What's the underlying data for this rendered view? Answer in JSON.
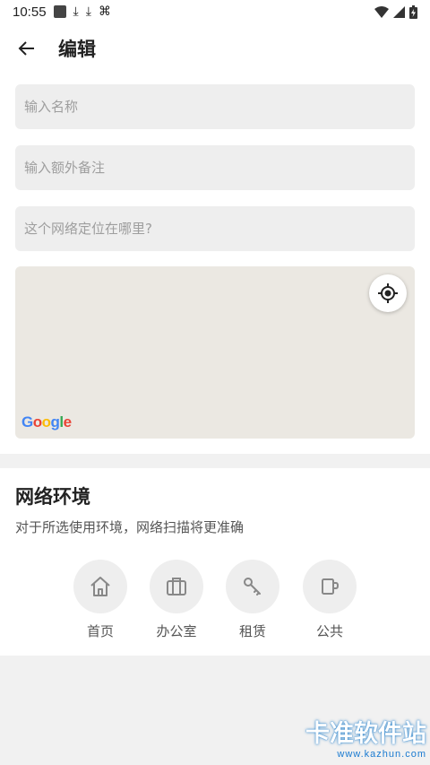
{
  "status_bar": {
    "time": "10:55",
    "notification_icons": [
      "stop-icon",
      "download-icon",
      "download-icon",
      "app-icon"
    ],
    "system_icons": [
      "wifi-icon",
      "signal-icon",
      "battery-charging-icon"
    ]
  },
  "app_bar": {
    "back_icon": "arrow-left-icon",
    "title": "编辑"
  },
  "form": {
    "name_placeholder": "输入名称",
    "note_placeholder": "输入额外备注",
    "location_placeholder": "这个网络定位在哪里?"
  },
  "map": {
    "logo_text": "Google",
    "locate_icon": "my-location-icon",
    "background_color": "#ebe8e2"
  },
  "environment": {
    "title": "网络环境",
    "subtitle": "对于所选使用环境，网络扫描将更准确",
    "options": [
      {
        "label": "首页",
        "icon": "home-icon"
      },
      {
        "label": "办公室",
        "icon": "briefcase-icon"
      },
      {
        "label": "租赁",
        "icon": "key-icon"
      },
      {
        "label": "公共",
        "icon": "coffee-cup-icon"
      }
    ]
  },
  "watermark": {
    "main": "卡准软件站",
    "sub": "www.kazhun.com"
  }
}
